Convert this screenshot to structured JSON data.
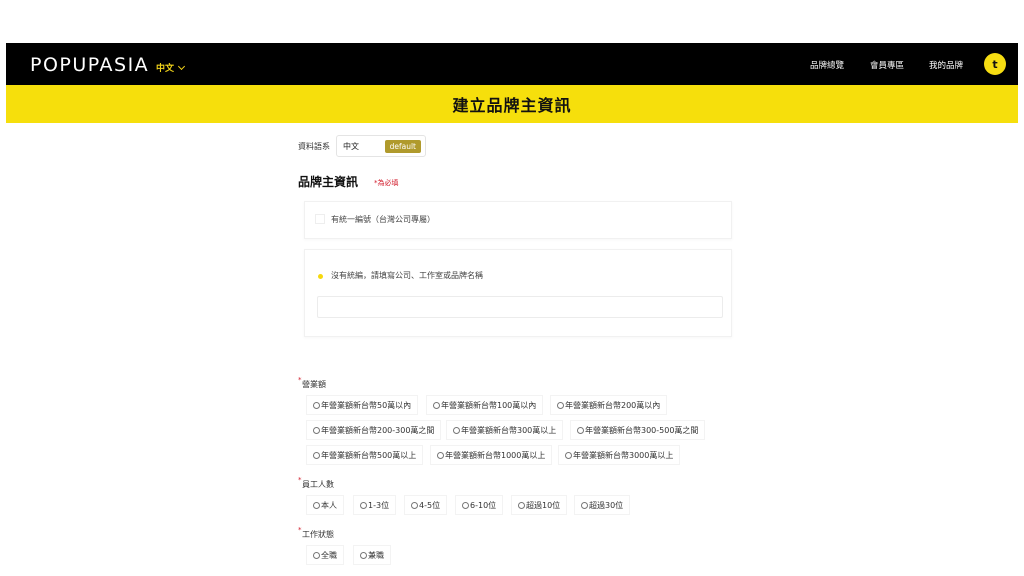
{
  "header": {
    "logo": "POPUPASIA",
    "language": "中文",
    "nav": [
      "品牌總覽",
      "會員專區",
      "我的品牌"
    ],
    "avatar_initial": "t"
  },
  "banner": {
    "title": "建立品牌主資訊"
  },
  "form": {
    "data_language_label": "資料語系",
    "data_language_value": "中文",
    "default_badge": "default",
    "section_title": "品牌主資訊",
    "required_note": "*為必填",
    "option_tax_id": "有統一編號（台灣公司專屬）",
    "option_no_tax_id": "沒有統編，請填寫公司、工作室或品牌名稱",
    "brand_name_value": "",
    "revenue": {
      "label": "營業額",
      "options": [
        "年營業額新台幣50萬以內",
        "年營業額新台幣100萬以內",
        "年營業額新台幣200萬以內",
        "年營業額新台幣200-300萬之間",
        "年營業額新台幣300萬以上",
        "年營業額新台幣300-500萬之間",
        "年營業額新台幣500萬以上",
        "年營業額新台幣1000萬以上",
        "年營業額新台幣3000萬以上"
      ]
    },
    "staff": {
      "label": "員工人數",
      "options": [
        "本人",
        "1-3位",
        "4-5位",
        "6-10位",
        "超過10位",
        "超過30位"
      ]
    },
    "work_status": {
      "label": "工作狀態",
      "options": [
        "全職",
        "兼職"
      ]
    }
  },
  "colors": {
    "accent_yellow": "#f6df0c",
    "header_black": "#000000",
    "required_red": "#d11a2a",
    "badge_gold": "#b09a2c"
  }
}
